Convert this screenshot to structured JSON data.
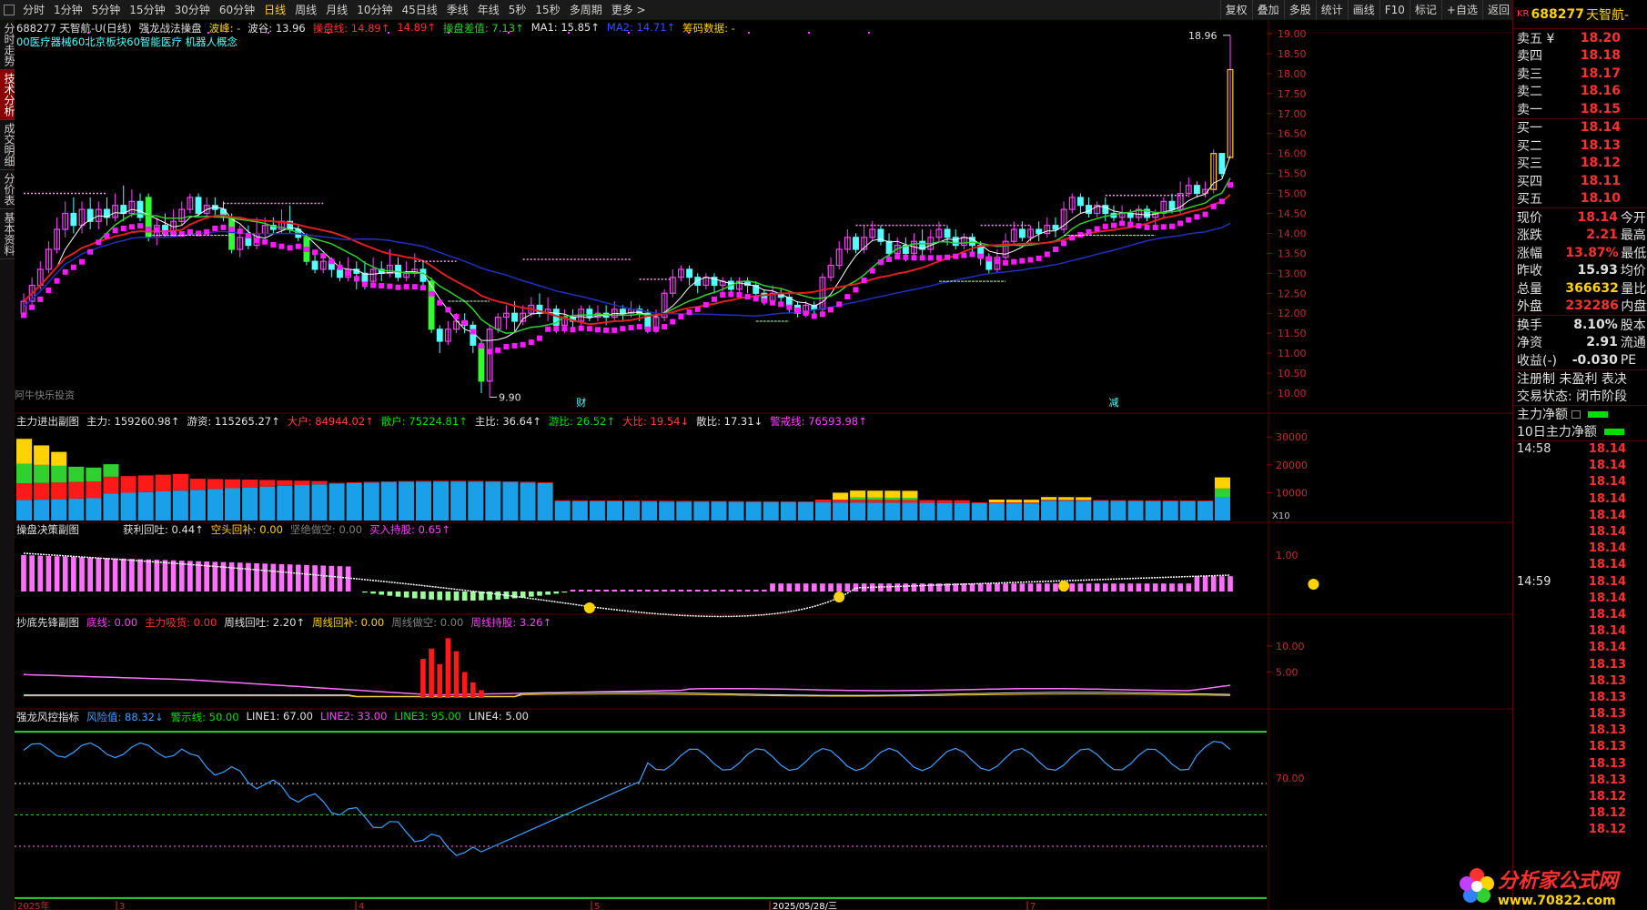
{
  "toolbar": {
    "tabs": [
      "分时",
      "1分钟",
      "5分钟",
      "15分钟",
      "30分钟",
      "60分钟",
      "日线",
      "周线",
      "月线",
      "10分钟",
      "45日线",
      "季线",
      "年线",
      "5秒",
      "15秒",
      "多周期",
      "更多 >"
    ],
    "active": "日线",
    "right_buttons": [
      "复权",
      "叠加",
      "多股",
      "统计",
      "画线",
      "F10",
      "标记",
      "+自选",
      "返回"
    ]
  },
  "left_tabs": [
    "分时走势",
    "技术分析",
    "成交明细",
    "分价表",
    "基本资料"
  ],
  "left_tabs_active": "技术分析",
  "main_legend": {
    "stock": "688277 天智航-U(日线)",
    "indicator": "强龙战法操盘",
    "peak": "波峰: -",
    "trough": "波谷: 13.96",
    "op_line": "操盘线: 14.89↑",
    "op_line2": "14.89↑",
    "diff": "操盘差值: 7.13↑",
    "ma1": "MA1: 15.85↑",
    "ma2": "MA2: 14.71↑",
    "chip": "筹码数据: -",
    "concepts": "00医疗器械60北京板块60智能医疗 机器人概念"
  },
  "main_chart_labels": {
    "high": "18.96",
    "low": "9.90",
    "watermark": "阿牛快乐投资",
    "marker_cai": "财",
    "marker_jian": "减"
  },
  "price_axis": [
    "19.00",
    "18.50",
    "18.00",
    "17.50",
    "17.00",
    "16.50",
    "16.00",
    "15.50",
    "15.00",
    "14.50",
    "14.00",
    "13.50",
    "13.00",
    "12.50",
    "12.00",
    "11.50",
    "11.00",
    "10.50",
    "10.00"
  ],
  "panel1": {
    "title": "主力进出副图",
    "items": [
      {
        "t": "主力: 159260.98↑",
        "c": "#e0e0e0"
      },
      {
        "t": "游资: 115265.27↑",
        "c": "#e0e0e0"
      },
      {
        "t": "大户: 84944.02↑",
        "c": "#ff4040"
      },
      {
        "t": "散户: 75224.81↑",
        "c": "#00e000"
      },
      {
        "t": "主比: 36.64↑",
        "c": "#e0e0e0"
      },
      {
        "t": "游比: 26.52↑",
        "c": "#00e000"
      },
      {
        "t": "大比: 19.54↓",
        "c": "#ff4040"
      },
      {
        "t": "散比: 17.31↓",
        "c": "#e0e0e0"
      },
      {
        "t": "警戒线: 76593.98↑",
        "c": "#ff40ff"
      }
    ],
    "axis": [
      "30000",
      "20000",
      "10000"
    ],
    "scale": "X10"
  },
  "panel2": {
    "title": "操盘决策副图",
    "items": [
      {
        "t": "获利回吐: 0.44↑",
        "c": "#e0e0e0"
      },
      {
        "t": "空头回补: 0.00",
        "c": "#ffd200"
      },
      {
        "t": "坚绝做空: 0.00",
        "c": "#808080"
      },
      {
        "t": "买入持股: 0.65↑",
        "c": "#ff40ff"
      }
    ],
    "axis": [
      "1.00"
    ]
  },
  "panel3": {
    "title": "抄底先锋副图",
    "items": [
      {
        "t": "底线: 0.00",
        "c": "#ff40ff"
      },
      {
        "t": "主力吸货: 0.00",
        "c": "#ff3030"
      },
      {
        "t": "周线回吐: 2.20↑",
        "c": "#e0e0e0"
      },
      {
        "t": "周线回补: 0.00",
        "c": "#ffd200"
      },
      {
        "t": "周线做空: 0.00",
        "c": "#808080"
      },
      {
        "t": "周线持股: 3.26↑",
        "c": "#ff40ff"
      }
    ],
    "axis": [
      "10.00",
      "5.00"
    ]
  },
  "panel4": {
    "title": "强龙风控指标",
    "items": [
      {
        "t": "风险值: 88.32↓",
        "c": "#40a0ff"
      },
      {
        "t": "警示线: 50.00",
        "c": "#00e000"
      },
      {
        "t": "LINE1: 67.00",
        "c": "#e0e0e0"
      },
      {
        "t": "LINE2: 33.00",
        "c": "#ff40ff"
      },
      {
        "t": "LINE3: 95.00",
        "c": "#00e000"
      },
      {
        "t": "LINE4: 5.00",
        "c": "#e0e0e0"
      }
    ],
    "axis": [
      "70.00"
    ]
  },
  "date_axis": [
    "2025年",
    "3",
    "4",
    "5",
    "2025/05/28/三",
    "7"
  ],
  "quote": {
    "market": "KR",
    "code": "688277",
    "name": "天智航-",
    "asks": [
      {
        "label": "卖五 ¥",
        "price": "18.20"
      },
      {
        "label": "卖四",
        "price": "18.18"
      },
      {
        "label": "卖三",
        "price": "18.17"
      },
      {
        "label": "卖二",
        "price": "18.16"
      },
      {
        "label": "卖一",
        "price": "18.15"
      }
    ],
    "bids": [
      {
        "label": "买一",
        "price": "18.14"
      },
      {
        "label": "买二",
        "price": "18.13"
      },
      {
        "label": "买三",
        "price": "18.12"
      },
      {
        "label": "买四",
        "price": "18.11"
      },
      {
        "label": "买五",
        "price": "18.10"
      }
    ],
    "stats1": [
      {
        "label": "现价",
        "val": "18.14",
        "extra": "今开",
        "cls": ""
      },
      {
        "label": "涨跌",
        "val": "2.21",
        "extra": "最高",
        "cls": ""
      },
      {
        "label": "涨幅",
        "val": "13.87%",
        "extra": "最低",
        "cls": ""
      },
      {
        "label": "昨收",
        "val": "15.93",
        "extra": "均价",
        "cls": "white"
      },
      {
        "label": "总量",
        "val": "366632",
        "extra": "量比",
        "cls": "yellow"
      },
      {
        "label": "外盘",
        "val": "232286",
        "extra": "内盘",
        "cls": ""
      }
    ],
    "stats2": [
      {
        "label": "换手",
        "val": "8.10%",
        "extra": "股本",
        "cls": "white"
      },
      {
        "label": "净资",
        "val": "2.91",
        "extra": "流通",
        "cls": "white"
      },
      {
        "label": "收益(-)",
        "val": "-0.030",
        "extra": "PE",
        "cls": "white"
      }
    ],
    "reg": "注册制 未盈利 表决",
    "status": "交易状态: 闭市阶段",
    "flow1": "主力净额",
    "flow2": "10日主力净额",
    "ticks": [
      {
        "t": "14:58",
        "p": "18.14"
      },
      {
        "t": "",
        "p": "18.14"
      },
      {
        "t": "",
        "p": "18.14"
      },
      {
        "t": "",
        "p": "18.14"
      },
      {
        "t": "",
        "p": "18.14"
      },
      {
        "t": "",
        "p": "18.14"
      },
      {
        "t": "",
        "p": "18.14"
      },
      {
        "t": "",
        "p": "18.14"
      },
      {
        "t": "14:59",
        "p": "18.14"
      },
      {
        "t": "",
        "p": "18.14"
      },
      {
        "t": "",
        "p": "18.14"
      },
      {
        "t": "",
        "p": "18.14"
      },
      {
        "t": "",
        "p": "18.14"
      },
      {
        "t": "",
        "p": "18.13"
      },
      {
        "t": "",
        "p": "18.13"
      },
      {
        "t": "",
        "p": "18.13"
      },
      {
        "t": "",
        "p": "18.13"
      },
      {
        "t": "",
        "p": "18.13"
      },
      {
        "t": "",
        "p": "18.13"
      },
      {
        "t": "",
        "p": "18.13"
      },
      {
        "t": "",
        "p": "18.13"
      },
      {
        "t": "",
        "p": "18.12"
      },
      {
        "t": "",
        "p": "18.12"
      },
      {
        "t": "",
        "p": "18.12"
      }
    ]
  },
  "watermark": {
    "main": "分析家公式网",
    "url": "www.70822.com"
  },
  "chart_data": {
    "type": "candlestick",
    "candles": [
      [
        12.0,
        12.3,
        11.9,
        12.5
      ],
      [
        12.3,
        12.7,
        12.2,
        12.9
      ],
      [
        12.7,
        13.1,
        12.6,
        13.3
      ],
      [
        13.1,
        13.6,
        13.0,
        13.8
      ],
      [
        13.6,
        14.1,
        13.5,
        14.4
      ],
      [
        14.1,
        14.5,
        13.9,
        14.8
      ],
      [
        14.5,
        14.2,
        14.0,
        14.9
      ],
      [
        14.2,
        14.6,
        14.0,
        14.8
      ],
      [
        14.6,
        14.3,
        14.1,
        14.9
      ],
      [
        14.3,
        14.6,
        14.1,
        14.8
      ],
      [
        14.6,
        14.4,
        14.2,
        14.9
      ],
      [
        14.4,
        14.7,
        14.3,
        15.0
      ],
      [
        14.7,
        14.5,
        14.3,
        15.2
      ],
      [
        14.5,
        14.8,
        14.4,
        15.1
      ],
      [
        14.8,
        14.4,
        14.3,
        15.0
      ],
      [
        14.9,
        13.9,
        13.8,
        15.0
      ],
      [
        13.9,
        14.2,
        13.7,
        14.4
      ],
      [
        14.2,
        14.0,
        13.9,
        14.5
      ],
      [
        14.0,
        14.3,
        13.9,
        14.6
      ],
      [
        14.3,
        14.6,
        14.2,
        14.8
      ],
      [
        14.6,
        14.9,
        14.5,
        15.0
      ],
      [
        14.9,
        14.5,
        14.4,
        15.0
      ],
      [
        14.5,
        14.7,
        14.4,
        14.9
      ],
      [
        14.7,
        14.6,
        14.4,
        14.9
      ],
      [
        14.6,
        14.4,
        14.3,
        14.8
      ],
      [
        14.4,
        13.6,
        13.5,
        14.5
      ],
      [
        13.6,
        13.9,
        13.4,
        14.2
      ],
      [
        13.9,
        13.7,
        13.6,
        14.2
      ],
      [
        13.7,
        14.0,
        13.6,
        14.4
      ],
      [
        14.0,
        14.2,
        13.9,
        14.4
      ],
      [
        14.2,
        14.1,
        14.0,
        14.4
      ],
      [
        14.1,
        14.3,
        14.0,
        14.6
      ],
      [
        14.3,
        14.1,
        14.0,
        14.7
      ],
      [
        14.1,
        13.9,
        13.8,
        14.2
      ],
      [
        13.9,
        13.3,
        13.2,
        14.0
      ],
      [
        13.3,
        13.1,
        13.0,
        13.5
      ],
      [
        13.1,
        13.3,
        13.0,
        13.5
      ],
      [
        13.3,
        13.1,
        12.9,
        13.4
      ],
      [
        13.1,
        12.9,
        12.8,
        13.3
      ],
      [
        12.9,
        13.1,
        12.8,
        13.4
      ],
      [
        13.1,
        13.0,
        12.6,
        13.3
      ],
      [
        13.0,
        12.8,
        12.6,
        13.3
      ],
      [
        12.8,
        13.1,
        12.7,
        13.4
      ],
      [
        13.1,
        13.0,
        12.8,
        13.3
      ],
      [
        13.0,
        13.2,
        12.9,
        13.6
      ],
      [
        13.2,
        12.9,
        12.8,
        13.4
      ],
      [
        12.9,
        13.0,
        12.8,
        13.3
      ],
      [
        13.0,
        13.1,
        12.9,
        13.5
      ],
      [
        13.1,
        12.8,
        12.7,
        13.3
      ],
      [
        12.8,
        11.6,
        11.5,
        12.9
      ],
      [
        11.6,
        11.3,
        11.0,
        11.7
      ],
      [
        11.3,
        11.6,
        11.2,
        11.8
      ],
      [
        11.6,
        11.8,
        11.5,
        12.0
      ],
      [
        11.8,
        11.7,
        11.5,
        12.0
      ],
      [
        11.7,
        11.2,
        11.0,
        11.8
      ],
      [
        11.2,
        10.3,
        10.0,
        11.3
      ],
      [
        10.3,
        11.6,
        9.9,
        11.7
      ],
      [
        11.6,
        11.9,
        11.5,
        12.0
      ],
      [
        11.9,
        12.0,
        11.6,
        12.2
      ],
      [
        12.0,
        11.8,
        11.5,
        12.3
      ],
      [
        11.8,
        12.0,
        11.7,
        12.2
      ],
      [
        12.0,
        12.2,
        11.9,
        12.4
      ],
      [
        12.2,
        12.0,
        11.9,
        12.5
      ],
      [
        12.0,
        12.1,
        11.8,
        12.4
      ],
      [
        12.1,
        11.7,
        11.5,
        12.2
      ],
      [
        11.7,
        11.9,
        11.5,
        12.1
      ],
      [
        11.9,
        11.8,
        11.6,
        12.1
      ],
      [
        11.8,
        12.1,
        11.7,
        12.2
      ],
      [
        12.1,
        11.9,
        11.8,
        12.2
      ],
      [
        11.9,
        12.0,
        11.8,
        12.2
      ],
      [
        12.0,
        11.9,
        11.7,
        12.2
      ],
      [
        11.9,
        12.1,
        11.8,
        12.3
      ],
      [
        12.1,
        12.0,
        11.8,
        12.2
      ],
      [
        12.0,
        12.1,
        11.9,
        12.3
      ],
      [
        12.1,
        12.0,
        11.8,
        12.2
      ],
      [
        12.0,
        11.6,
        11.5,
        12.1
      ],
      [
        11.6,
        11.9,
        11.5,
        12.1
      ],
      [
        11.9,
        12.5,
        11.8,
        12.6
      ],
      [
        12.5,
        12.9,
        12.4,
        13.1
      ],
      [
        12.9,
        13.1,
        12.8,
        13.2
      ],
      [
        13.1,
        12.9,
        12.7,
        13.2
      ],
      [
        12.9,
        12.7,
        12.5,
        13.0
      ],
      [
        12.7,
        12.9,
        12.6,
        13.0
      ],
      [
        12.9,
        12.7,
        12.5,
        13.0
      ],
      [
        12.7,
        12.8,
        12.5,
        12.9
      ],
      [
        12.8,
        12.6,
        12.4,
        12.9
      ],
      [
        12.6,
        12.8,
        12.5,
        12.9
      ],
      [
        12.8,
        12.7,
        12.5,
        12.9
      ],
      [
        12.7,
        12.5,
        12.4,
        12.8
      ],
      [
        12.5,
        12.3,
        12.2,
        12.6
      ],
      [
        12.3,
        12.5,
        12.2,
        12.7
      ],
      [
        12.5,
        12.4,
        12.2,
        12.6
      ],
      [
        12.4,
        12.2,
        12.0,
        12.5
      ],
      [
        12.2,
        12.0,
        11.9,
        12.3
      ],
      [
        12.0,
        12.2,
        11.9,
        12.3
      ],
      [
        12.2,
        12.1,
        11.9,
        12.3
      ],
      [
        12.1,
        12.9,
        12.0,
        13.0
      ],
      [
        12.9,
        13.2,
        12.8,
        13.4
      ],
      [
        13.2,
        13.6,
        13.1,
        13.8
      ],
      [
        13.6,
        13.9,
        13.5,
        14.1
      ],
      [
        13.9,
        13.6,
        13.5,
        14.0
      ],
      [
        13.6,
        13.9,
        13.5,
        14.2
      ],
      [
        13.9,
        14.1,
        13.8,
        14.3
      ],
      [
        14.1,
        13.8,
        13.7,
        14.2
      ],
      [
        13.8,
        13.5,
        13.4,
        14.0
      ],
      [
        13.5,
        13.7,
        13.4,
        13.9
      ],
      [
        13.7,
        13.5,
        13.3,
        13.9
      ],
      [
        13.5,
        13.8,
        13.4,
        14.0
      ],
      [
        13.8,
        13.6,
        13.4,
        14.1
      ],
      [
        13.6,
        13.9,
        13.5,
        14.1
      ],
      [
        13.9,
        14.1,
        13.8,
        14.3
      ],
      [
        14.1,
        13.9,
        13.7,
        14.2
      ],
      [
        13.9,
        13.7,
        13.6,
        14.1
      ],
      [
        13.7,
        13.9,
        13.6,
        14.0
      ],
      [
        13.9,
        13.7,
        13.5,
        14.0
      ],
      [
        13.7,
        13.4,
        13.2,
        13.8
      ],
      [
        13.4,
        13.1,
        13.0,
        13.5
      ],
      [
        13.1,
        13.4,
        13.0,
        13.6
      ],
      [
        13.4,
        13.8,
        13.3,
        14.0
      ],
      [
        13.8,
        14.1,
        13.7,
        14.3
      ],
      [
        14.1,
        13.9,
        13.8,
        14.3
      ],
      [
        13.9,
        14.1,
        13.8,
        14.2
      ],
      [
        14.1,
        14.0,
        13.8,
        14.3
      ],
      [
        14.0,
        14.2,
        13.9,
        14.4
      ],
      [
        14.2,
        14.1,
        13.9,
        14.4
      ],
      [
        14.1,
        14.6,
        14.0,
        14.8
      ],
      [
        14.6,
        14.9,
        14.5,
        15.0
      ],
      [
        14.9,
        14.7,
        14.5,
        15.0
      ],
      [
        14.7,
        14.5,
        14.4,
        14.9
      ],
      [
        14.5,
        14.7,
        14.4,
        14.8
      ],
      [
        14.7,
        14.5,
        14.3,
        14.9
      ],
      [
        14.5,
        14.4,
        14.3,
        14.7
      ],
      [
        14.4,
        14.5,
        14.3,
        14.7
      ],
      [
        14.5,
        14.4,
        14.2,
        14.6
      ],
      [
        14.4,
        14.6,
        14.3,
        14.7
      ],
      [
        14.6,
        14.4,
        14.3,
        14.7
      ],
      [
        14.4,
        14.5,
        14.2,
        14.6
      ],
      [
        14.5,
        14.8,
        14.4,
        14.9
      ],
      [
        14.8,
        14.6,
        14.5,
        15.0
      ],
      [
        14.6,
        15.0,
        14.5,
        15.3
      ],
      [
        15.0,
        15.2,
        14.9,
        15.4
      ],
      [
        15.2,
        15.0,
        14.9,
        15.3
      ],
      [
        15.0,
        15.1,
        14.9,
        15.3
      ],
      [
        15.1,
        16.0,
        15.0,
        16.1
      ],
      [
        16.0,
        15.5,
        15.4,
        16.0
      ],
      [
        15.9,
        18.1,
        15.9,
        18.96
      ]
    ],
    "price_range": [
      10.0,
      19.0
    ],
    "panel4_lines": {
      "warning": 50,
      "line1": 67,
      "line2": 33,
      "line3": 95,
      "line4": 5
    }
  },
  "colors": {
    "up": "#ff40ff",
    "down": "#54ffff",
    "bull_bar": "#ff1a1a",
    "ma_red": "#e02020",
    "ma_blue": "#2030c0",
    "ma_green": "#30d030",
    "ma_white": "#ffffff"
  }
}
